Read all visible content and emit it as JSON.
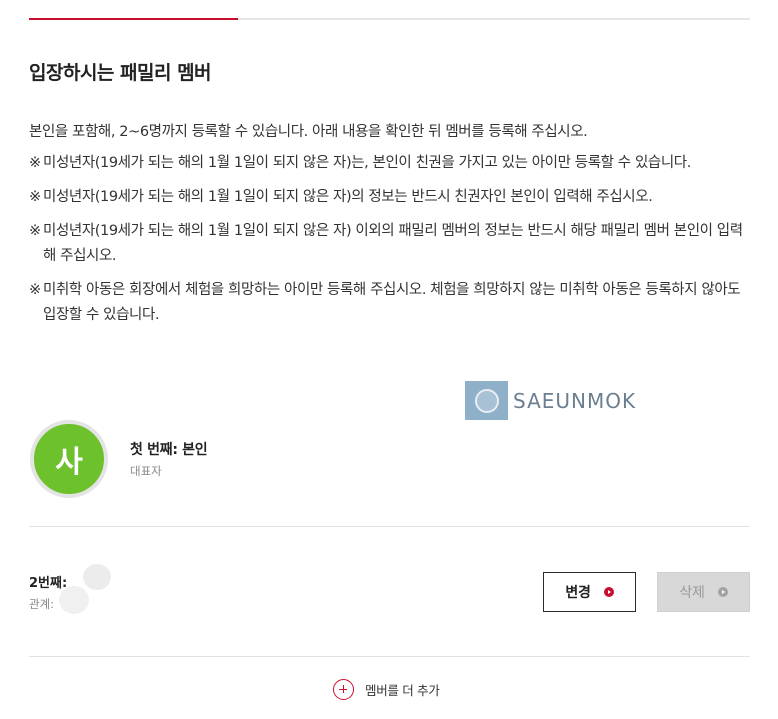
{
  "section": {
    "title": "입장하시는 패밀리 멤버",
    "intro": "본인을 포함해, 2~6명까지 등록할 수 있습니다. 아래 내용을 확인한 뒤 멤버를 등록해 주십시오.",
    "notes": [
      "미성년자(19세가 되는 해의 1월 1일이 되지 않은 자)는, 본인이 친권을 가지고 있는 아이만 등록할 수 있습니다.",
      "미성년자(19세가 되는 해의 1월 1일이 되지 않은 자)의 정보는 반드시 친권자인 본인이 입력해 주십시오.",
      "미성년자(19세가 되는 해의 1월 1일이 되지 않은 자) 이외의 패밀리 멤버의 정보는 반드시 해당 패밀리 멤버 본인이 입력해 주십시오.",
      "미취학 아동은 회장에서 체험을 희망하는 아이만 등록해 주십시오. 체험을 희망하지 않는 미취학 아동은 등록하지 않아도 입장할 수 있습니다."
    ],
    "note_mark": "※"
  },
  "watermark": {
    "text": "SAEUNMOK"
  },
  "member1": {
    "avatar_initial": "사",
    "avatar_color": "#6cc12c",
    "name": "첫 번째: 본인",
    "role": "대표자"
  },
  "member2": {
    "label": "2번째:",
    "relation_label": "관계:",
    "change_button": "변경",
    "delete_button": "삭제"
  },
  "add_member": {
    "label": "멤버를 더 추가"
  },
  "colors": {
    "accent": "#c8102e",
    "avatar": "#6cc12c",
    "disabled": "#d8d8d8"
  }
}
